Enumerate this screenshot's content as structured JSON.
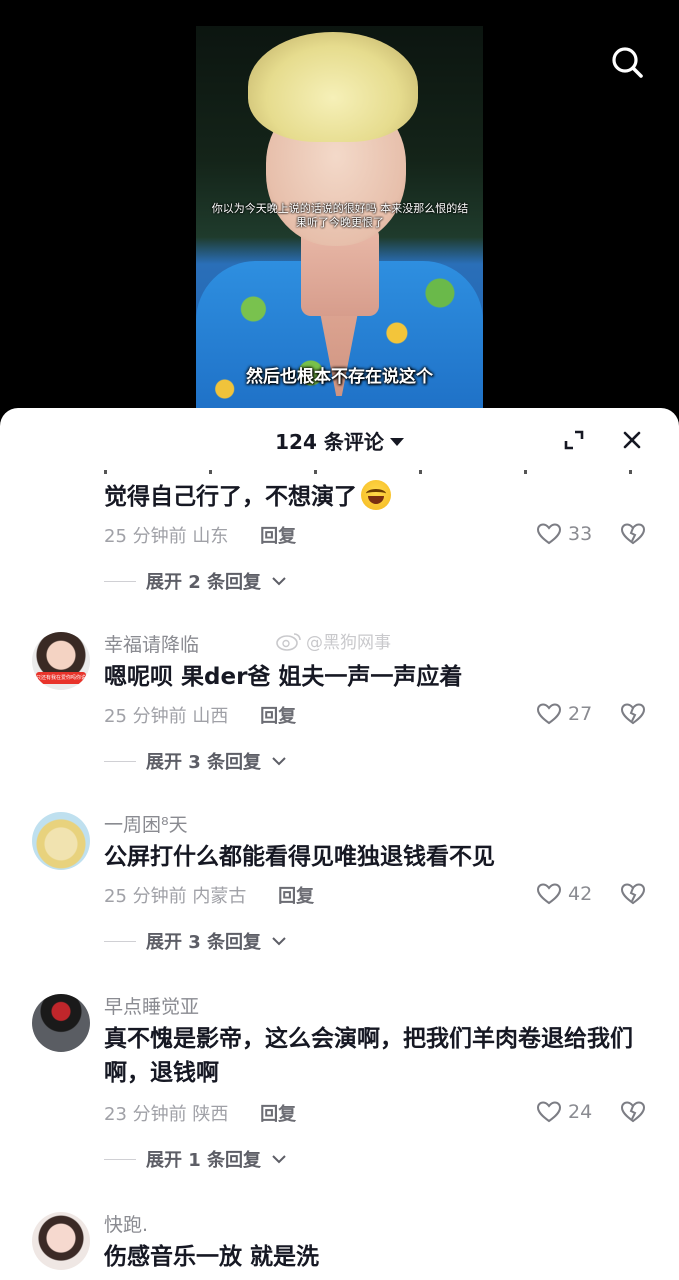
{
  "video": {
    "subtitle_top": "你以为今天晚上说的话说的很好吗 本来没那么恨的结果听了今晚更恨了",
    "subtitle_bottom": "然后也根本不存在说这个"
  },
  "sheet": {
    "title": "124 条评论"
  },
  "watermark": "@黑狗网事",
  "comments": [
    {
      "text": "觉得自己行了，不想演了",
      "time": "25 分钟前",
      "location": "山东",
      "reply_label": "回复",
      "likes": "33",
      "expand_label": "展开 2 条回复"
    },
    {
      "username": "幸福请降临",
      "text": "嗯呢呗 果der爸 姐夫一声一声应着",
      "time": "25 分钟前",
      "location": "山西",
      "reply_label": "回复",
      "likes": "27",
      "expand_label": "展开 3 条回复",
      "avatar_caption": "只还有我在爱你吗你说呀"
    },
    {
      "username": "一周困⁸天",
      "text": "公屏打什么都能看得见唯独退钱看不见",
      "time": "25 分钟前",
      "location": "内蒙古",
      "reply_label": "回复",
      "likes": "42",
      "expand_label": "展开 3 条回复"
    },
    {
      "username": "早点睡觉亚",
      "text": "真不愧是影帝，这么会演啊，把我们羊肉卷退给我们啊，退钱啊",
      "time": "23 分钟前",
      "location": "陕西",
      "reply_label": "回复",
      "likes": "24",
      "expand_label": "展开 1 条回复"
    },
    {
      "username": "快跑.",
      "text": "伤感音乐一放 就是洗"
    }
  ],
  "icons": {
    "search": "search-icon",
    "expand": "expand-icon",
    "close": "close-icon",
    "like": "heart-outline-icon",
    "dislike": "broken-heart-icon",
    "chevron": "chevron-down-icon"
  }
}
